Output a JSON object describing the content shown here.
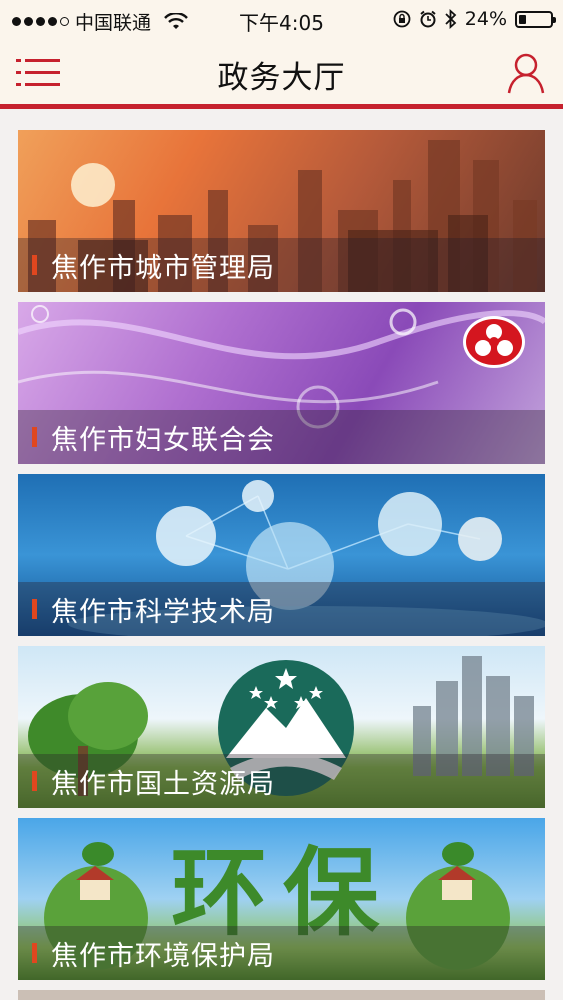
{
  "status_bar": {
    "carrier": "中国联通",
    "time": "下午4:05",
    "battery_percent": "24%",
    "battery_level": 0.24,
    "signal_bars": 4
  },
  "header": {
    "title": "政务大厅",
    "accent_color": "#c6212e"
  },
  "banners": [
    {
      "label": "焦作市城市管理局",
      "theme": "city-skyline"
    },
    {
      "label": "焦作市妇女联合会",
      "theme": "womens-federation-emblem"
    },
    {
      "label": "焦作市科学技术局",
      "theme": "technology-spheres"
    },
    {
      "label": "焦作市国土资源局",
      "theme": "land-resources-emblem"
    },
    {
      "label": "焦作市环境保护局",
      "theme": "environmental-protection",
      "art_text": "环保"
    }
  ]
}
